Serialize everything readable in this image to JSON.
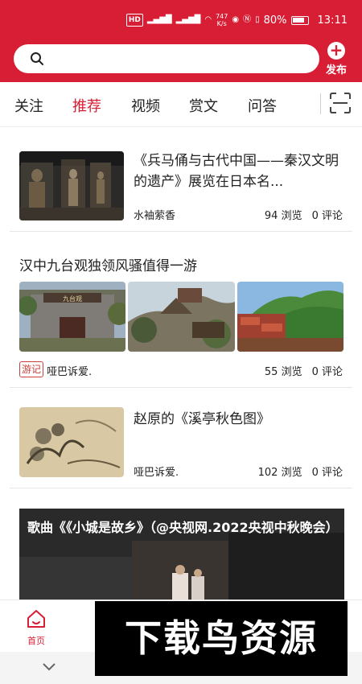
{
  "status_bar": {
    "network_speed": "747\nK/s",
    "battery": "80%",
    "time": "13:11"
  },
  "header": {
    "search_placeholder": "",
    "publish_label": "发布"
  },
  "tabs": [
    {
      "label": "关注",
      "active": false
    },
    {
      "label": "推荐",
      "active": true
    },
    {
      "label": "视频",
      "active": false
    },
    {
      "label": "赏文",
      "active": false
    },
    {
      "label": "问答",
      "active": false
    }
  ],
  "articles": [
    {
      "title": "《兵马俑与古代中国——秦汉文明的遗产》展览在日本名...",
      "author": "水袖萦香",
      "views": "94 浏览",
      "comments": "0 评论"
    },
    {
      "title": "汉中九台观独领风骚值得一游",
      "badge": "游记",
      "author": "哑巴诉爱.",
      "views": "55 浏览",
      "comments": "0 评论",
      "image_sign": "九台观"
    },
    {
      "title": "赵原的《溪亭秋色图》",
      "author": "哑巴诉爱.",
      "views": "102 浏览",
      "comments": "0 评论"
    },
    {
      "title": "歌曲《《小城是故乡》（@央视网.2022央视中秋晚会）"
    }
  ],
  "bottom_nav": {
    "home_label": "首页"
  },
  "watermark": "下载鸟资源",
  "colors": {
    "brand": "#d81e35"
  }
}
